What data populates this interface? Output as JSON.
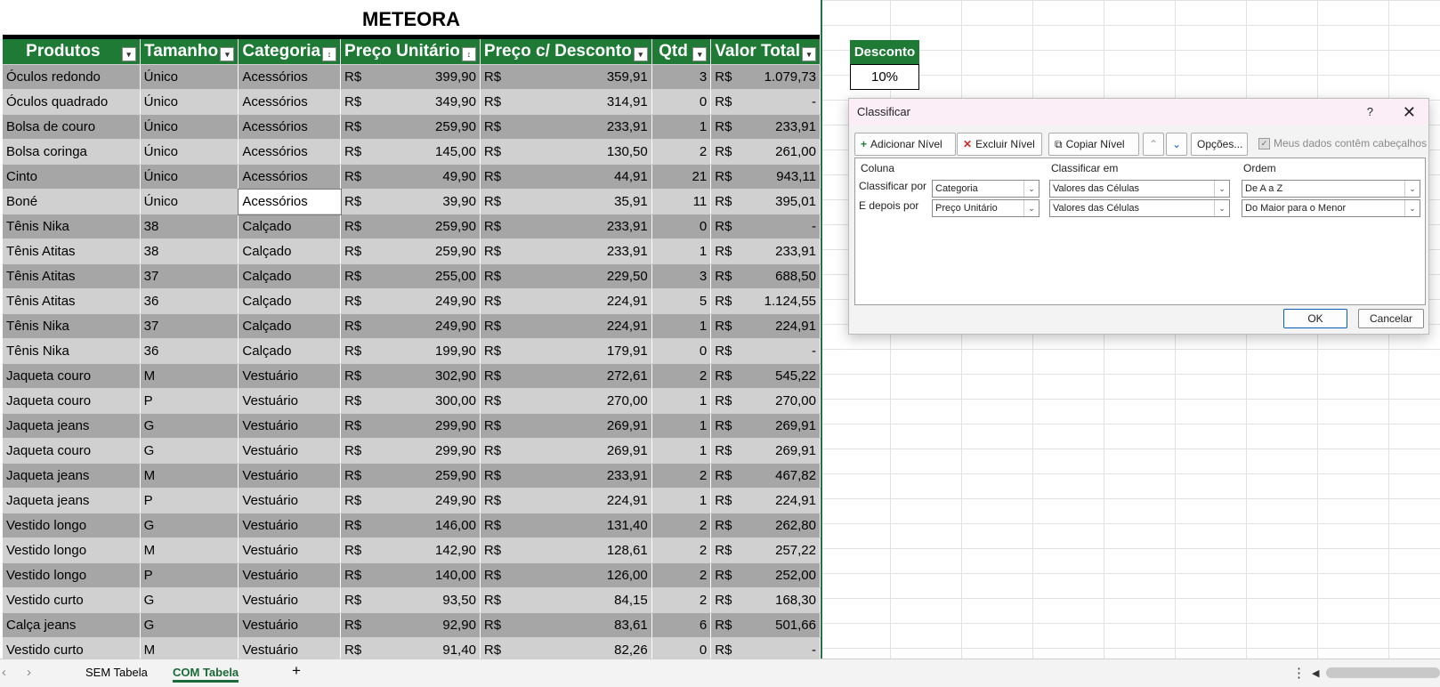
{
  "sheet_title": "METEORA",
  "columns": [
    "Produtos",
    "Tamanho",
    "Categoria",
    "Preço Unitário",
    "Preço c/ Desconto",
    "Qtd",
    "Valor Total"
  ],
  "currency": "R$",
  "rows": [
    [
      "Óculos redondo",
      "Único",
      "Acessórios",
      "399,90",
      "359,91",
      "3",
      "1.079,73"
    ],
    [
      "Óculos quadrado",
      "Único",
      "Acessórios",
      "349,90",
      "314,91",
      "0",
      "-"
    ],
    [
      "Bolsa de couro",
      "Único",
      "Acessórios",
      "259,90",
      "233,91",
      "1",
      "233,91"
    ],
    [
      "Bolsa coringa",
      "Único",
      "Acessórios",
      "145,00",
      "130,50",
      "2",
      "261,00"
    ],
    [
      "Cinto",
      "Único",
      "Acessórios",
      "49,90",
      "44,91",
      "21",
      "943,11"
    ],
    [
      "Boné",
      "Único",
      "Acessórios",
      "39,90",
      "35,91",
      "11",
      "395,01"
    ],
    [
      "Tênis Nika",
      "38",
      "Calçado",
      "259,90",
      "233,91",
      "0",
      "-"
    ],
    [
      "Tênis Atitas",
      "38",
      "Calçado",
      "259,90",
      "233,91",
      "1",
      "233,91"
    ],
    [
      "Tênis Atitas",
      "37",
      "Calçado",
      "255,00",
      "229,50",
      "3",
      "688,50"
    ],
    [
      "Tênis Atitas",
      "36",
      "Calçado",
      "249,90",
      "224,91",
      "5",
      "1.124,55"
    ],
    [
      "Tênis Nika",
      "37",
      "Calçado",
      "249,90",
      "224,91",
      "1",
      "224,91"
    ],
    [
      "Tênis Nika",
      "36",
      "Calçado",
      "199,90",
      "179,91",
      "0",
      "-"
    ],
    [
      "Jaqueta couro",
      "M",
      "Vestuário",
      "302,90",
      "272,61",
      "2",
      "545,22"
    ],
    [
      "Jaqueta couro",
      "P",
      "Vestuário",
      "300,00",
      "270,00",
      "1",
      "270,00"
    ],
    [
      "Jaqueta jeans",
      "G",
      "Vestuário",
      "299,90",
      "269,91",
      "1",
      "269,91"
    ],
    [
      "Jaqueta couro",
      "G",
      "Vestuário",
      "299,90",
      "269,91",
      "1",
      "269,91"
    ],
    [
      "Jaqueta jeans",
      "M",
      "Vestuário",
      "259,90",
      "233,91",
      "2",
      "467,82"
    ],
    [
      "Jaqueta jeans",
      "P",
      "Vestuário",
      "249,90",
      "224,91",
      "1",
      "224,91"
    ],
    [
      "Vestido longo",
      "G",
      "Vestuário",
      "146,00",
      "131,40",
      "2",
      "262,80"
    ],
    [
      "Vestido longo",
      "M",
      "Vestuário",
      "142,90",
      "128,61",
      "2",
      "257,22"
    ],
    [
      "Vestido longo",
      "P",
      "Vestuário",
      "140,00",
      "126,00",
      "2",
      "252,00"
    ],
    [
      "Vestido curto",
      "G",
      "Vestuário",
      "93,50",
      "84,15",
      "2",
      "168,30"
    ],
    [
      "Calça jeans",
      "G",
      "Vestuário",
      "92,90",
      "83,61",
      "6",
      "501,66"
    ],
    [
      "Vestido curto",
      "M",
      "Vestuário",
      "91,40",
      "82,26",
      "0",
      "-"
    ]
  ],
  "selected_cell": {
    "row": 5,
    "col": 2
  },
  "discount": {
    "label": "Desconto",
    "value": "10%"
  },
  "dialog": {
    "title": "Classificar",
    "help": "?",
    "close": "✕",
    "add_level": "Adicionar Nível",
    "delete_level": "Excluir Nível",
    "copy_level": "Copiar Nível",
    "options": "Opções...",
    "headers_checkbox": "Meus dados contêm cabeçalhos",
    "col_header": "Coluna",
    "sort_on_header": "Classificar em",
    "order_header": "Ordem",
    "levels": [
      {
        "label": "Classificar por",
        "column": "Categoria",
        "sort_on": "Valores das Células",
        "order": "De A a Z"
      },
      {
        "label": "E depois por",
        "column": "Preço Unitário",
        "sort_on": "Valores das Células",
        "order": "Do Maior para o Menor"
      }
    ],
    "ok": "OK",
    "cancel": "Cancelar"
  },
  "tabs": [
    "SEM Tabela",
    "COM Tabela"
  ],
  "active_tab": 1,
  "add_sheet": "+",
  "colors": {
    "header_green": "#1f7a36",
    "row_dark": "#a6a6a6",
    "row_light": "#d0d0d0",
    "active_tab": "#1a6a37"
  }
}
